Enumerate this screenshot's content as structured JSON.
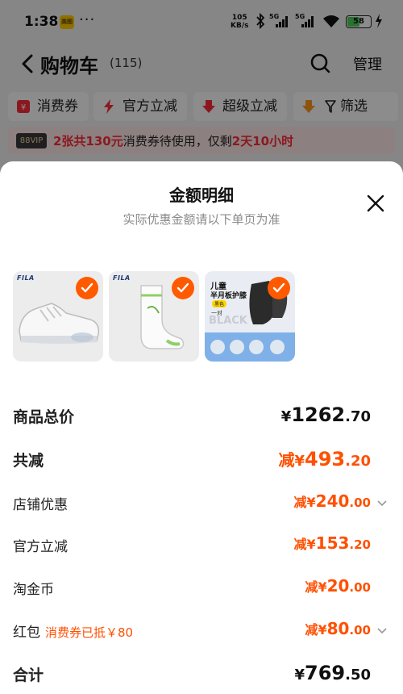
{
  "status_bar": {
    "time": "1:38",
    "app_badge": "美图",
    "more": "···",
    "net_speed_value": "105",
    "net_speed_unit": "KB/s",
    "sim1": "5G",
    "sim2": "5G",
    "battery_percent": 58
  },
  "nav": {
    "title": "购物车",
    "count": "(115)",
    "manage_label": "管理"
  },
  "filters": {
    "chips": [
      "消费券",
      "官方立减",
      "超级立减",
      "降"
    ],
    "filter_label": "筛选"
  },
  "coupon_banner": {
    "vip": "88VIP",
    "highlight1": "2张共130元",
    "text1": "消费券待使用，仅剩",
    "highlight2": "2天10小时"
  },
  "sheet": {
    "title": "金额明细",
    "subtitle": "实际优惠金额请以下单页为准",
    "products": [
      {
        "name": "sneaker",
        "brand": "FILA",
        "checked": true
      },
      {
        "name": "sock",
        "brand": "FILA",
        "checked": true
      },
      {
        "name": "knee-pad",
        "line1": "儿童",
        "line2": "半月板护膝",
        "line3": "黑色",
        "line4": "一对",
        "line5": "BLACK",
        "checked": true
      }
    ],
    "rows": {
      "total": {
        "label": "商品总价",
        "symbol": "¥",
        "int": "1262",
        "dec": ".70"
      },
      "discount": {
        "label": "共减",
        "prefix": "减",
        "symbol": "¥",
        "int": "493",
        "dec": ".20"
      },
      "shop": {
        "label": "店铺优惠",
        "prefix": "减",
        "symbol": "¥",
        "int": "240",
        "dec": ".00"
      },
      "official": {
        "label": "官方立减",
        "prefix": "减",
        "symbol": "¥",
        "int": "153",
        "dec": ".20"
      },
      "coin": {
        "label": "淘金币",
        "prefix": "减",
        "symbol": "¥",
        "int": "20",
        "dec": ".00"
      },
      "redpacket": {
        "label": "红包",
        "tag": "消费券已抵￥80",
        "prefix": "减",
        "symbol": "¥",
        "int": "80",
        "dec": ".00"
      },
      "sum": {
        "label": "合计",
        "symbol": "¥",
        "int": "769",
        "dec": ".50"
      }
    }
  },
  "colors": {
    "accent": "#ff5000",
    "check": "#ff5a00",
    "banner_red": "#ff2d3a"
  }
}
